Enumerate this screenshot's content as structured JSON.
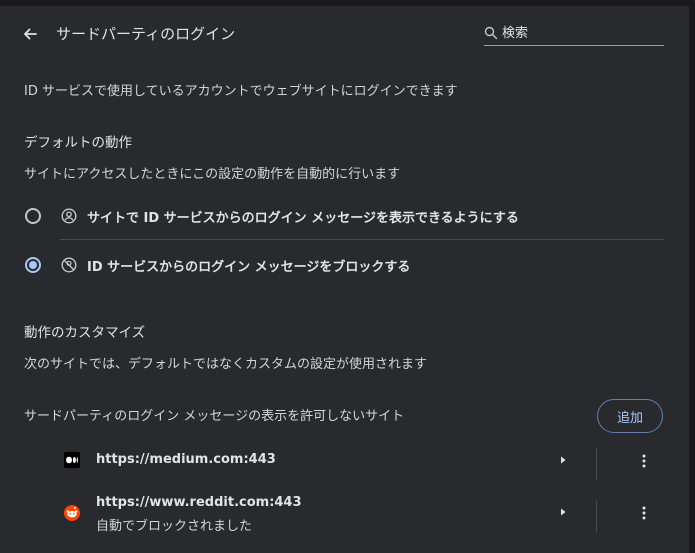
{
  "header": {
    "back_icon": "arrow-left-icon",
    "title": "サードパーティのログイン",
    "search_icon": "search-icon",
    "search_placeholder": "検索"
  },
  "description": "ID サービスで使用しているアカウントでウェブサイトにログインできます",
  "default_behavior": {
    "heading": "デフォルトの動作",
    "subtext": "サイトにアクセスしたときにこの設定の動作を自動的に行います",
    "options": [
      {
        "icon": "account-circle-icon",
        "label": "サイトで ID サービスからのログイン メッセージを表示できるようにする",
        "selected": false
      },
      {
        "icon": "blocked-account-icon",
        "label": "ID サービスからのログイン メッセージをブロックする",
        "selected": true
      }
    ]
  },
  "customize": {
    "heading": "動作のカスタマイズ",
    "subtext": "次のサイトでは、デフォルトではなくカスタムの設定が使用されます"
  },
  "blocked_sites": {
    "label": "サードパーティのログイン メッセージの表示を許可しないサイト",
    "add_label": "追加",
    "items": [
      {
        "favicon": "medium-logo-icon",
        "url": "https://medium.com:443",
        "sub": ""
      },
      {
        "favicon": "reddit-logo-icon",
        "url": "https://www.reddit.com:443",
        "sub": "自動でブロックされました"
      }
    ]
  },
  "colors": {
    "background": "#282a2e",
    "accent": "#a8c7fa",
    "text": "#e3e3e3"
  }
}
